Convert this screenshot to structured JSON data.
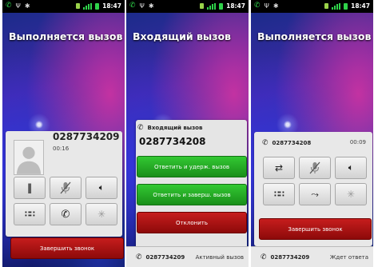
{
  "status_bar": {
    "time": "18:47"
  },
  "screen1": {
    "title": "Выполняется вызов",
    "number": "0287734209",
    "duration": "00:16",
    "end_label": "Завершить звонок"
  },
  "screen2": {
    "title": "Входящий вызов",
    "incoming_label": "Входящий вызов",
    "number": "0287734208",
    "answer_hold_label": "Ответить и удерж. вызов",
    "answer_end_label": "Ответить и заверш. вызов",
    "decline_label": "Отклонить",
    "bottom_number": "0287734209",
    "bottom_status": "Активный вызов"
  },
  "screen3": {
    "title": "Выполняется вызов",
    "number": "0287734208",
    "duration": "00:09",
    "end_label": "Завершить звонок",
    "bottom_number": "0287734209",
    "bottom_status": "Ждет ответа"
  },
  "icons": {
    "hold": "pause-icon",
    "mute": "mic-off-icon",
    "speaker": "speaker-icon",
    "dialpad": "dialpad-icon",
    "add_call": "add-call-icon",
    "bluetooth": "bluetooth-icon",
    "swap": "swap-icon",
    "merge": "merge-icon"
  },
  "colors": {
    "end_red": "#b01414",
    "answer_green": "#24a824",
    "status_green": "#2fd34a"
  }
}
